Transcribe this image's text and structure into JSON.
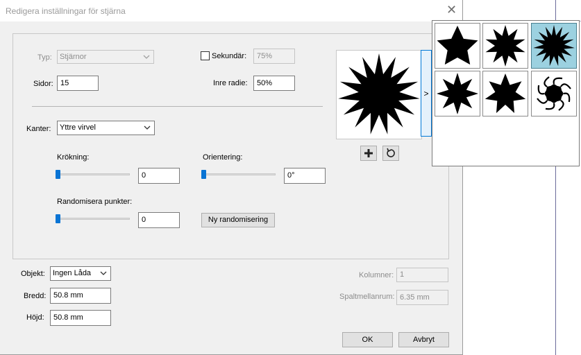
{
  "dialog": {
    "title": "Redigera inställningar för stjärna",
    "type": {
      "label": "Typ:",
      "value": "Stjärnor"
    },
    "secondary": {
      "label": "Sekundär:",
      "value": "75%",
      "checked": false
    },
    "sides": {
      "label": "Sidor:",
      "value": "15"
    },
    "inner_radius": {
      "label": "Inre radie:",
      "value": "50%"
    },
    "edges": {
      "label": "Kanter:",
      "value": "Yttre virvel"
    },
    "curvature": {
      "label": "Krökning:",
      "value": "0",
      "level": 0
    },
    "orientation": {
      "label": "Orientering:",
      "value": "0°",
      "level": 0
    },
    "randomize_points": {
      "label": "Randomisera punkter:",
      "value": "0",
      "level": 0
    },
    "new_randomize_label": "Ny randomisering",
    "object": {
      "label": "Objekt:",
      "value": "Ingen Låda"
    },
    "width": {
      "label": "Bredd:",
      "value": "50.8 mm"
    },
    "height": {
      "label": "Höjd:",
      "value": "50.8 mm"
    },
    "columns": {
      "label": "Kolumner:",
      "value": "1"
    },
    "gutter": {
      "label": "Spaltmellanrum:",
      "value": "6.35 mm"
    },
    "ok_label": "OK",
    "cancel_label": "Avbryt",
    "preview_arrow": ">"
  },
  "icons": {
    "close": "close-icon",
    "add": "plus-icon",
    "reset": "reset-icon",
    "dropdown": "chevron-down-icon"
  },
  "presets": [
    {
      "name": "five-point-star",
      "selected": false
    },
    {
      "name": "ten-point-star",
      "selected": false
    },
    {
      "name": "fifteen-point-star",
      "selected": true
    },
    {
      "name": "eight-point-star",
      "selected": false
    },
    {
      "name": "seven-point-star",
      "selected": false
    },
    {
      "name": "swirl-star",
      "selected": false
    }
  ],
  "colors": {
    "accent": "#0a74d4",
    "selected_cell": "#9cd1e0"
  }
}
